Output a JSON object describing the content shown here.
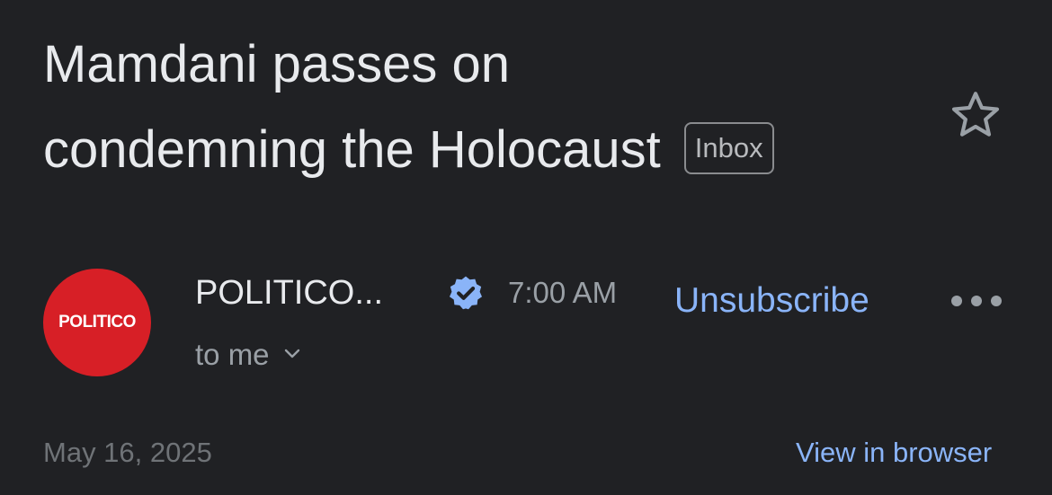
{
  "email": {
    "subject_line_1": "Mamdani passes on",
    "subject_line_2": "condemning the Holocaust",
    "label": "Inbox",
    "sender": {
      "name": "POLITICO...",
      "avatar_text": "POLITICO",
      "avatar_color": "#d71f26",
      "verified": true
    },
    "time": "7:00 AM",
    "unsubscribe_label": "Unsubscribe",
    "recipient": "to me",
    "date": "May 16, 2025",
    "view_in_browser_label": "View in browser"
  },
  "icons": {
    "star": "star-icon",
    "verified": "verified-badge-icon",
    "more": "more-horizontal-icon",
    "chevron": "chevron-down-icon"
  },
  "colors": {
    "background": "#202124",
    "text_primary": "#e8eaed",
    "text_secondary": "#9aa0a6",
    "link": "#8ab4f8",
    "verified_badge": "#8ab4f8"
  }
}
